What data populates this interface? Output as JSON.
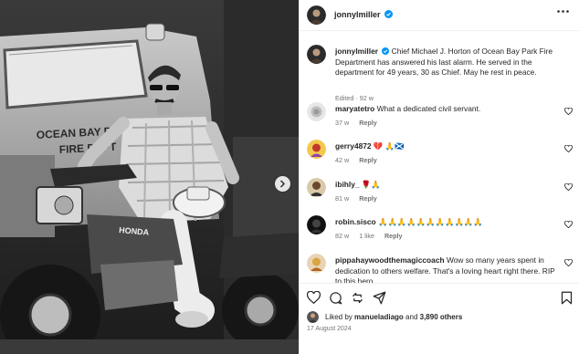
{
  "photo": {
    "alt": "Chief Michael J. Horton seated on a Honda three-wheeler in front of an Ocean Bay Park fire truck",
    "truck_text_line1": "OCEAN BAY PARK",
    "truck_text_line2": "FIRE DEPT",
    "bike_brand": "HONDA"
  },
  "header": {
    "username": "jonnylmiller",
    "verified": true
  },
  "caption": {
    "username": "jonnylmiller",
    "text": "Chief Michael J. Horton of Ocean Bay Park Fire Department has answered his last alarm. He served in the department for 49 years, 30 as Chief. May he rest in peace.",
    "meta": "Edited · 92 w"
  },
  "comments": [
    {
      "username": "maryatetro",
      "text": "What a dedicated civil servant.",
      "time": "37 w",
      "reply": "Reply",
      "likes": ""
    },
    {
      "username": "gerry4872",
      "text": "💔 🙏🏴󠁧󠁢󠁳󠁣󠁴󠁿",
      "time": "42 w",
      "reply": "Reply",
      "likes": ""
    },
    {
      "username": "ibihly_",
      "text": "🌹🙏",
      "time": "81 w",
      "reply": "Reply",
      "likes": ""
    },
    {
      "username": "robin.sisco",
      "text": "🙏🙏🙏🙏🙏🙏🙏🙏🙏🙏🙏",
      "time": "82 w",
      "reply": "Reply",
      "likes": "1 like"
    },
    {
      "username": "pippahaywoodthemagiccoach",
      "text": "Wow so many years spent in dedication to others welfare. That's a loving heart right there. RIP to this hero",
      "time": "",
      "reply": "",
      "likes": ""
    }
  ],
  "footer": {
    "liked_by_prefix": "Liked by ",
    "liked_by_user": "manueladiago",
    "liked_by_and": " and ",
    "liked_by_count": "3,890 others",
    "date": "17 August 2024"
  },
  "colors": {
    "verified": "#0095f6",
    "text": "#262626",
    "muted": "#737373",
    "divider": "#efefef"
  },
  "icons": [
    "more-icon",
    "verified-icon",
    "heart-icon",
    "comment-icon",
    "share-icon",
    "send-icon",
    "bookmark-icon",
    "chevron-right-icon"
  ]
}
